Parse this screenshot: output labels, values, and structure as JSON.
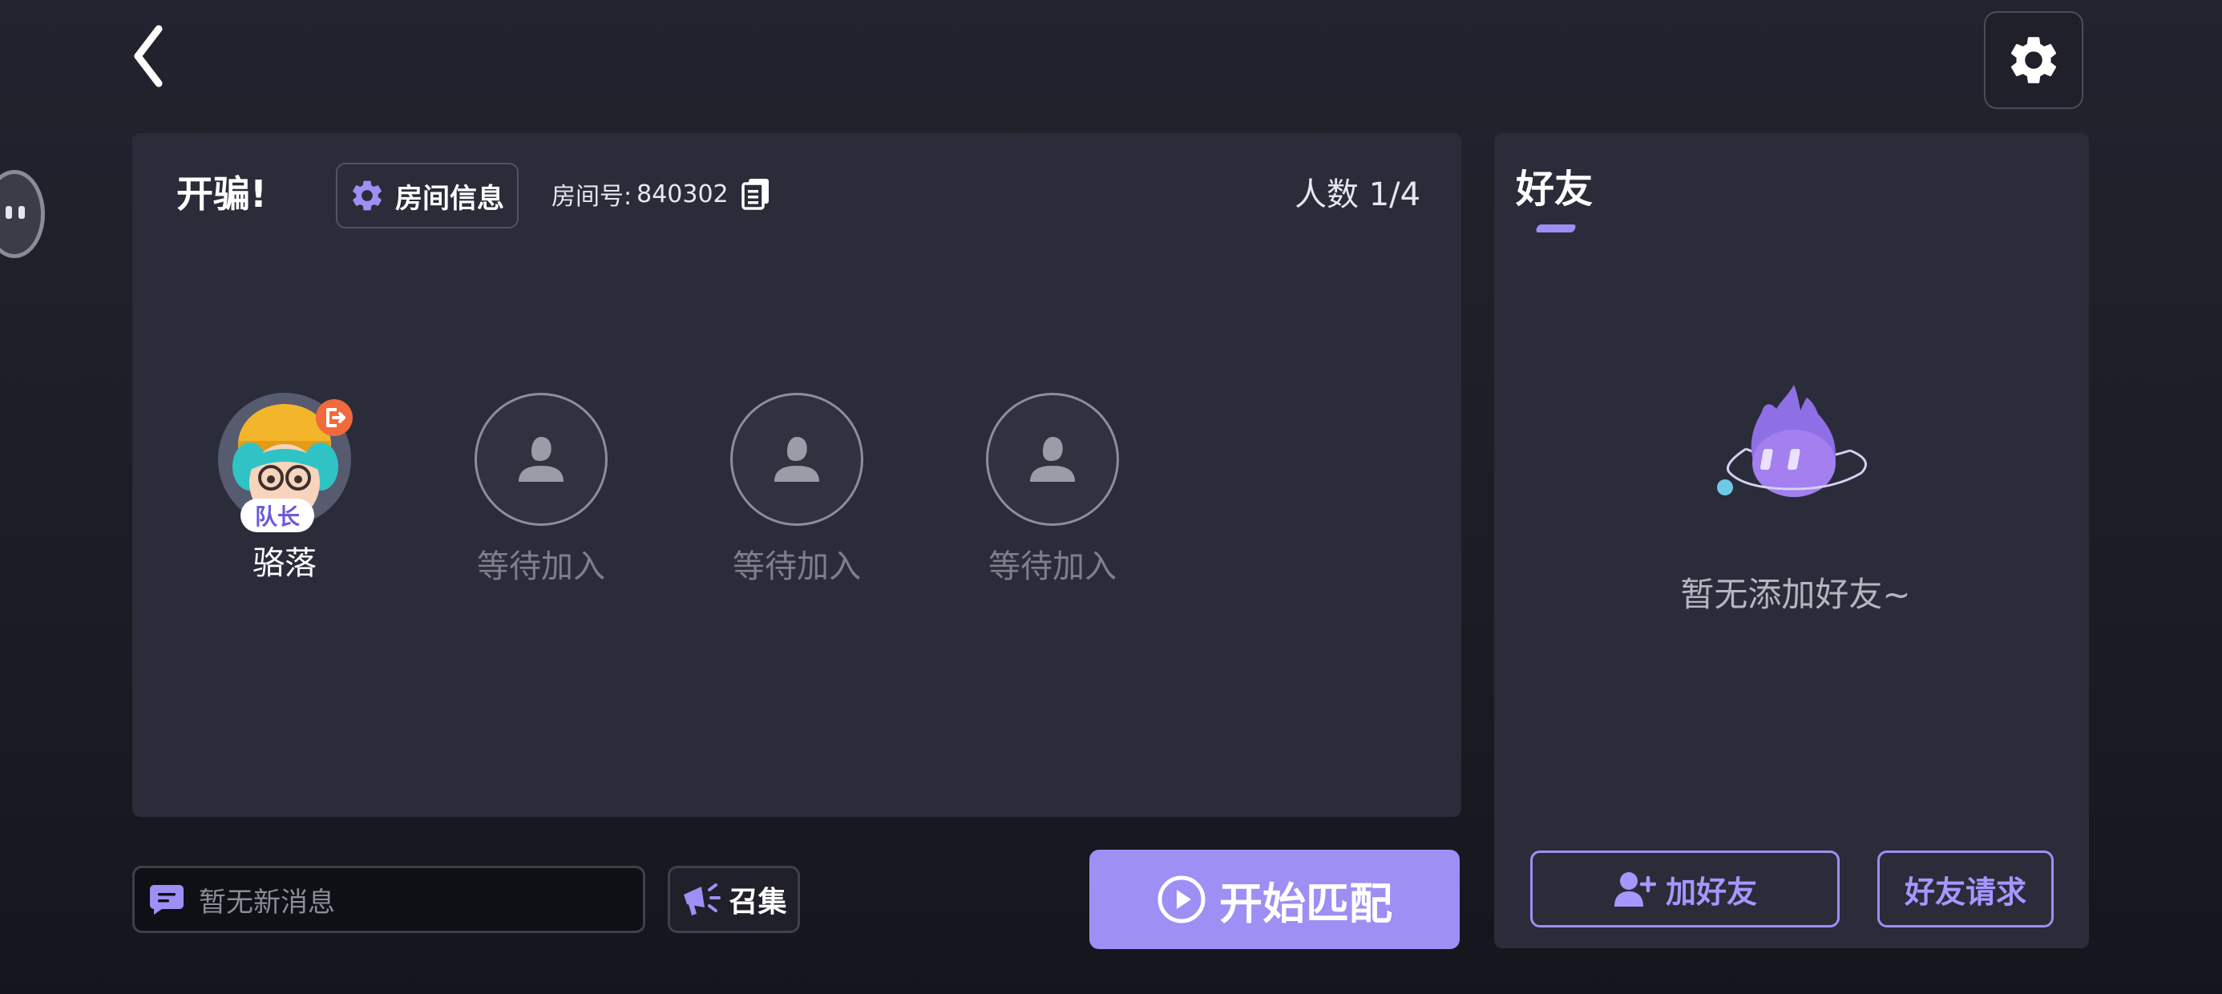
{
  "colors": {
    "accent": "#9d8ff4",
    "panel": "#2a2c39",
    "background": "#1b1c25",
    "exit_badge": "#f06a3c"
  },
  "header": {
    "back_icon": "chevron-left-icon",
    "settings_icon": "gear-icon"
  },
  "room": {
    "title": "开骗!",
    "info_button_label": "房间信息",
    "room_number_label": "房间号:",
    "room_number": "840302",
    "player_count": "人数 1/4",
    "slots": [
      {
        "name": "骆落",
        "badge": "队长",
        "state": "leader"
      },
      {
        "name": "等待加入",
        "state": "empty"
      },
      {
        "name": "等待加入",
        "state": "empty"
      },
      {
        "name": "等待加入",
        "state": "empty"
      }
    ]
  },
  "bottom": {
    "message_placeholder": "暂无新消息",
    "rally_label": "召集",
    "start_label": "开始匹配"
  },
  "friends": {
    "title": "好友",
    "empty_text": "暂无添加好友~",
    "add_friend_label": "加好友",
    "friend_request_label": "好友请求"
  }
}
